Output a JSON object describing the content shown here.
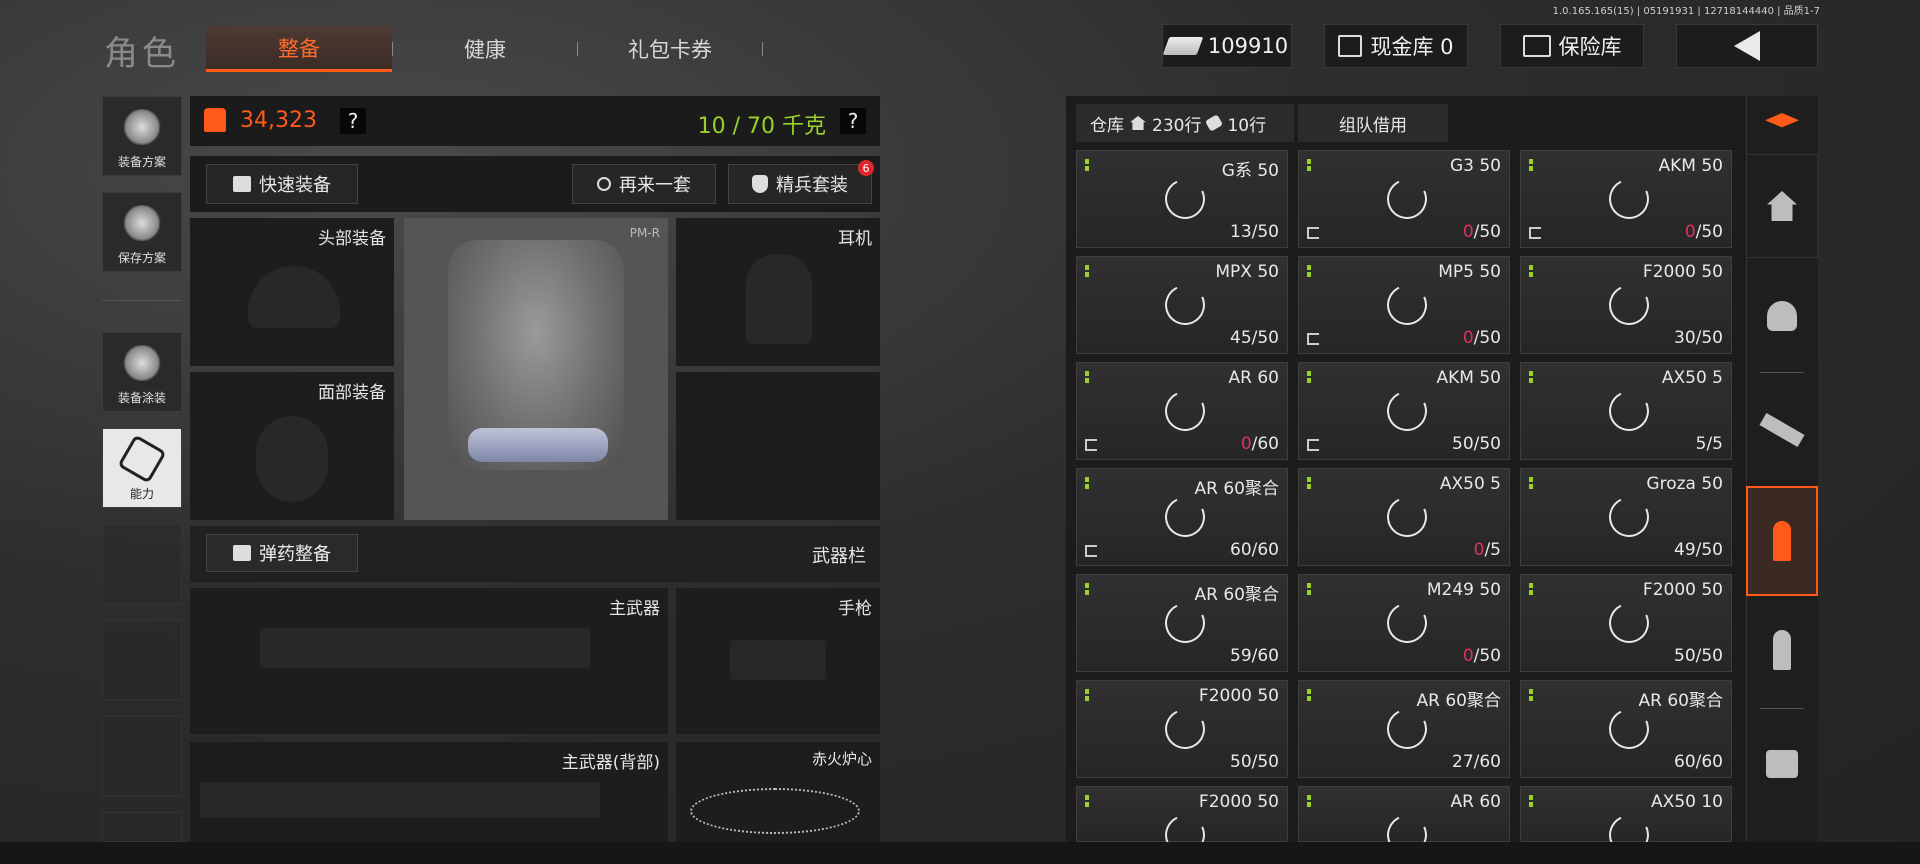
{
  "version": "1.0.165.165(15) | 05191931 | 12718144440 | 品质1-7",
  "header": {
    "title": "角色",
    "tabs": [
      "整备",
      "健康",
      "礼包卡券"
    ],
    "money": "109910",
    "cash_vault": "现金库 0",
    "safe": "保险库"
  },
  "sidebar": {
    "items": [
      {
        "label": "装备方案",
        "icon": "vest-icon"
      },
      {
        "label": "保存方案",
        "icon": "download-icon"
      },
      {
        "label": "装备涂装",
        "icon": "helmet-paint-icon"
      },
      {
        "label": "能力",
        "icon": "ability-icon"
      }
    ]
  },
  "loadout": {
    "value": "34,323",
    "weight": "10 / 70 千克",
    "help": "?",
    "quick_equip": "快速装备",
    "again": "再来一套",
    "elite": "精兵套装",
    "elite_badge": "6",
    "slots": {
      "head": "头部装备",
      "face": "面部装备",
      "headset": "耳机",
      "vest_tag": "PM-R",
      "ammo_btn": "弹药整备",
      "weapon_bar": "武器栏",
      "primary": "主武器",
      "pistol": "手枪",
      "primary_back": "主武器(背部)",
      "charm": "赤火炉心"
    }
  },
  "storage": {
    "tabs": {
      "warehouse": "仓库",
      "rows": "230行",
      "tickets": "10行",
      "team": "组队借用"
    },
    "cards": [
      {
        "name": "G系 50",
        "cur": "13",
        "max": "/50",
        "zero": false,
        "exit": false
      },
      {
        "name": "G3 50",
        "cur": "0",
        "max": "/50",
        "zero": true,
        "exit": true
      },
      {
        "name": "AKM 50",
        "cur": "0",
        "max": "/50",
        "zero": true,
        "exit": true
      },
      {
        "name": "MPX 50",
        "cur": "45",
        "max": "/50",
        "zero": false,
        "exit": false
      },
      {
        "name": "MP5 50",
        "cur": "0",
        "max": "/50",
        "zero": true,
        "exit": true
      },
      {
        "name": "F2000 50",
        "cur": "30",
        "max": "/50",
        "zero": false,
        "exit": false
      },
      {
        "name": "AR 60",
        "cur": "0",
        "max": "/60",
        "zero": true,
        "exit": true
      },
      {
        "name": "AKM 50",
        "cur": "50",
        "max": "/50",
        "zero": false,
        "exit": true
      },
      {
        "name": "AX50 5",
        "cur": "5",
        "max": "/5",
        "zero": false,
        "exit": false
      },
      {
        "name": "AR 60聚合",
        "cur": "60",
        "max": "/60",
        "zero": false,
        "exit": true
      },
      {
        "name": "AX50 5",
        "cur": "0",
        "max": "/5",
        "zero": true,
        "exit": false
      },
      {
        "name": "Groza 50",
        "cur": "49",
        "max": "/50",
        "zero": false,
        "exit": false
      },
      {
        "name": "AR 60聚合",
        "cur": "59",
        "max": "/60",
        "zero": false,
        "exit": false
      },
      {
        "name": "M249 50",
        "cur": "0",
        "max": "/50",
        "zero": true,
        "exit": false
      },
      {
        "name": "F2000 50",
        "cur": "50",
        "max": "/50",
        "zero": false,
        "exit": false
      },
      {
        "name": "F2000 50",
        "cur": "50",
        "max": "/50",
        "zero": false,
        "exit": false
      },
      {
        "name": "AR 60聚合",
        "cur": "27",
        "max": "/60",
        "zero": false,
        "exit": false
      },
      {
        "name": "AR 60聚合",
        "cur": "60",
        "max": "/60",
        "zero": false,
        "exit": false
      },
      {
        "name": "F2000 50",
        "cur": "",
        "max": "",
        "zero": false,
        "exit": false
      },
      {
        "name": "AR 60",
        "cur": "",
        "max": "",
        "zero": false,
        "exit": false
      },
      {
        "name": "AX50 10",
        "cur": "",
        "max": "",
        "zero": false,
        "exit": false
      }
    ]
  },
  "rail": {
    "icons": [
      "stack-refresh-icon",
      "home-icon",
      "helmet-icon",
      "rifle-icon",
      "ammo-icon",
      "ammo-gray-icon",
      "backpack-icon"
    ],
    "accent": "#ff5a1a"
  },
  "colors": {
    "accent": "#ff5a1a",
    "green": "#9ad22a",
    "zero_red": "#e0305a"
  }
}
